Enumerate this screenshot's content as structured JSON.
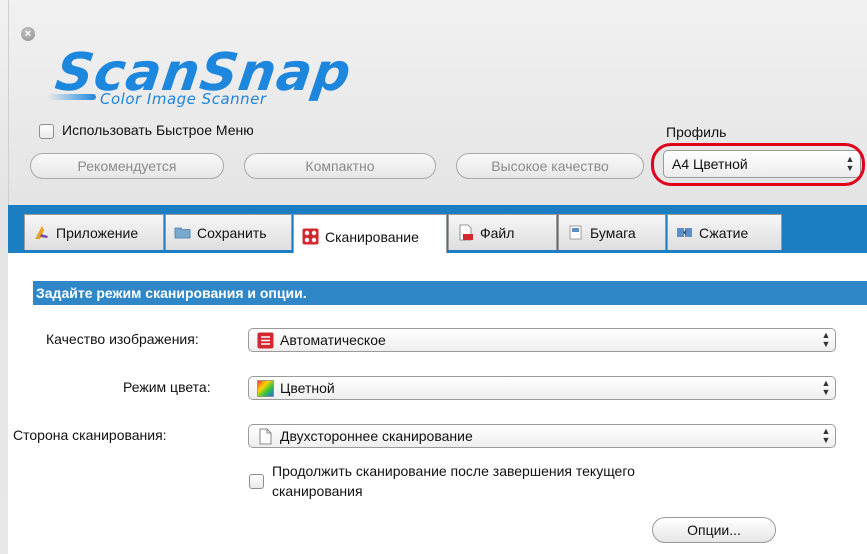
{
  "window": {
    "close_glyph": "×"
  },
  "logo": {
    "title": "ScanSnap",
    "subtitle": "Color Image Scanner",
    "color": "#1d86dd"
  },
  "quick_menu": {
    "label": "Использовать Быстрое Меню",
    "checked": false
  },
  "presets": {
    "recommended": "Рекомендуется",
    "compact": "Компактно",
    "high_quality": "Высокое качество"
  },
  "profile": {
    "label": "Профиль",
    "selected": "A4 Цветной",
    "highlight_color": "#e0001a"
  },
  "tabs": [
    {
      "label": "Приложение",
      "icon": "application-icon"
    },
    {
      "label": "Сохранить",
      "icon": "folder-icon"
    },
    {
      "label": "Сканирование",
      "icon": "scanning-icon",
      "active": true
    },
    {
      "label": "Файл",
      "icon": "file-icon"
    },
    {
      "label": "Бумага",
      "icon": "paper-icon"
    },
    {
      "label": "Сжатие",
      "icon": "compression-icon"
    }
  ],
  "section": {
    "title": "Задайте режим сканирования и опции."
  },
  "fields": {
    "image_quality": {
      "label": "Качество изображения:",
      "value": "Автоматическое",
      "icon": "auto-quality-icon"
    },
    "color_mode": {
      "label": "Режим цвета:",
      "value": "Цветной",
      "icon": "color-gradient-icon"
    },
    "scan_side": {
      "label": "Сторона сканирования:",
      "value": "Двухстороннее сканирование",
      "icon": "duplex-page-icon"
    }
  },
  "continue_scan": {
    "label_line1": "Продолжить сканирование после завершения текущего",
    "label_line2": "сканирования",
    "checked": false
  },
  "options_button": {
    "label": "Опции..."
  },
  "colors": {
    "tabbar": "#1b7dc2",
    "section_bar": "#2f87c8"
  }
}
